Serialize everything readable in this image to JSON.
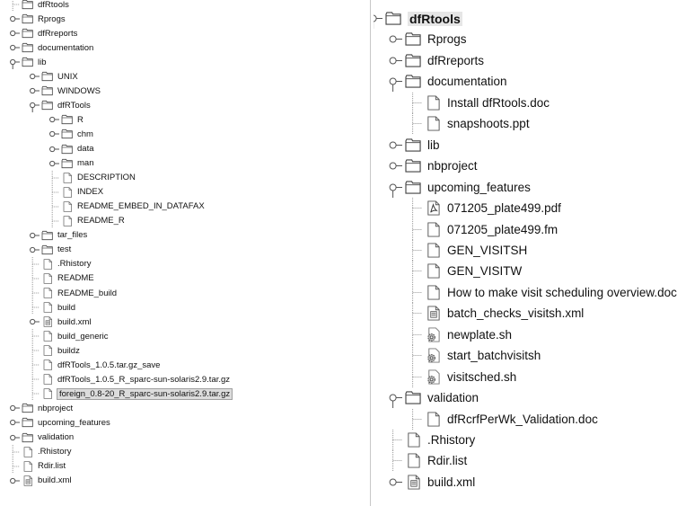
{
  "left_tree": {
    "rows": [
      {
        "label": "dfRtools",
        "depth": 0,
        "icon": "folder-icon",
        "state": "cut"
      },
      {
        "label": "Rprogs",
        "depth": 0,
        "icon": "folder-icon",
        "state": "collapsed"
      },
      {
        "label": "dfRreports",
        "depth": 0,
        "icon": "folder-icon",
        "state": "collapsed"
      },
      {
        "label": "documentation",
        "depth": 0,
        "icon": "folder-icon",
        "state": "collapsed"
      },
      {
        "label": "lib",
        "depth": 0,
        "icon": "folder-icon",
        "state": "expanded"
      },
      {
        "label": "UNIX",
        "depth": 1,
        "icon": "folder-icon",
        "state": "collapsed"
      },
      {
        "label": "WINDOWS",
        "depth": 1,
        "icon": "folder-icon",
        "state": "collapsed"
      },
      {
        "label": "dfRTools",
        "depth": 1,
        "icon": "folder-icon",
        "state": "expanded"
      },
      {
        "label": "R",
        "depth": 2,
        "icon": "folder-icon",
        "state": "collapsed"
      },
      {
        "label": "chm",
        "depth": 2,
        "icon": "folder-icon",
        "state": "collapsed"
      },
      {
        "label": "data",
        "depth": 2,
        "icon": "folder-icon",
        "state": "collapsed"
      },
      {
        "label": "man",
        "depth": 2,
        "icon": "folder-icon",
        "state": "collapsed"
      },
      {
        "label": "DESCRIPTION",
        "depth": 2,
        "icon": "file-icon",
        "state": "leaf"
      },
      {
        "label": "INDEX",
        "depth": 2,
        "icon": "file-icon",
        "state": "leaf"
      },
      {
        "label": "README_EMBED_IN_DATAFAX",
        "depth": 2,
        "icon": "file-icon",
        "state": "leaf"
      },
      {
        "label": "README_R",
        "depth": 2,
        "icon": "file-icon",
        "state": "leaf"
      },
      {
        "label": "tar_files",
        "depth": 1,
        "icon": "folder-icon",
        "state": "collapsed"
      },
      {
        "label": "test",
        "depth": 1,
        "icon": "folder-icon",
        "state": "collapsed"
      },
      {
        "label": ".Rhistory",
        "depth": 1,
        "icon": "file-icon",
        "state": "leaf"
      },
      {
        "label": "README",
        "depth": 1,
        "icon": "file-icon",
        "state": "leaf"
      },
      {
        "label": "README_build",
        "depth": 1,
        "icon": "file-icon",
        "state": "leaf"
      },
      {
        "label": "build",
        "depth": 1,
        "icon": "file-icon",
        "state": "leaf"
      },
      {
        "label": "build.xml",
        "depth": 1,
        "icon": "xml-file-icon",
        "state": "collapsed"
      },
      {
        "label": "build_generic",
        "depth": 1,
        "icon": "file-icon",
        "state": "leaf"
      },
      {
        "label": "buildz",
        "depth": 1,
        "icon": "file-icon",
        "state": "leaf"
      },
      {
        "label": "dfRTools_1.0.5.tar.gz_save",
        "depth": 1,
        "icon": "file-icon",
        "state": "leaf"
      },
      {
        "label": "dfRTools_1.0.5_R_sparc-sun-solaris2.9.tar.gz",
        "depth": 1,
        "icon": "file-icon",
        "state": "leaf"
      },
      {
        "label": "foreign_0.8-20_R_sparc-sun-solaris2.9.tar.gz",
        "depth": 1,
        "icon": "file-icon",
        "state": "leaf",
        "selected": true
      },
      {
        "label": "nbproject",
        "depth": 0,
        "icon": "folder-icon",
        "state": "collapsed"
      },
      {
        "label": "upcoming_features",
        "depth": 0,
        "icon": "folder-icon",
        "state": "collapsed"
      },
      {
        "label": "validation",
        "depth": 0,
        "icon": "folder-icon",
        "state": "collapsed"
      },
      {
        "label": ".Rhistory",
        "depth": 0,
        "icon": "file-icon",
        "state": "leaf"
      },
      {
        "label": "Rdir.list",
        "depth": 0,
        "icon": "file-icon",
        "state": "leaf"
      },
      {
        "label": "build.xml",
        "depth": 0,
        "icon": "xml-file-icon",
        "state": "collapsed"
      }
    ]
  },
  "right_tree": {
    "rows": [
      {
        "label": "dfRtools",
        "depth": 0,
        "icon": "folder-icon",
        "state": "root"
      },
      {
        "label": "Rprogs",
        "depth": 1,
        "icon": "folder-icon",
        "state": "collapsed"
      },
      {
        "label": "dfRreports",
        "depth": 1,
        "icon": "folder-icon",
        "state": "collapsed"
      },
      {
        "label": "documentation",
        "depth": 1,
        "icon": "folder-icon",
        "state": "expanded"
      },
      {
        "label": "Install dfRtools.doc",
        "depth": 2,
        "icon": "file-icon",
        "state": "leaf"
      },
      {
        "label": "snapshoots.ppt",
        "depth": 2,
        "icon": "file-icon",
        "state": "leaf"
      },
      {
        "label": "lib",
        "depth": 1,
        "icon": "folder-icon",
        "state": "collapsed"
      },
      {
        "label": "nbproject",
        "depth": 1,
        "icon": "folder-icon",
        "state": "collapsed"
      },
      {
        "label": "upcoming_features",
        "depth": 1,
        "icon": "folder-icon",
        "state": "expanded"
      },
      {
        "label": "071205_plate499.pdf",
        "depth": 2,
        "icon": "pdf-file-icon",
        "state": "leaf"
      },
      {
        "label": "071205_plate499.fm",
        "depth": 2,
        "icon": "file-icon",
        "state": "leaf"
      },
      {
        "label": "GEN_VISITSH",
        "depth": 2,
        "icon": "file-icon",
        "state": "leaf"
      },
      {
        "label": "GEN_VISITW",
        "depth": 2,
        "icon": "file-icon",
        "state": "leaf"
      },
      {
        "label": "How to make visit scheduling overview.doc",
        "depth": 2,
        "icon": "file-icon",
        "state": "leaf"
      },
      {
        "label": "batch_checks_visitsh.xml",
        "depth": 2,
        "icon": "xml-file-icon",
        "state": "leaf"
      },
      {
        "label": "newplate.sh",
        "depth": 2,
        "icon": "gear-file-icon",
        "state": "leaf"
      },
      {
        "label": "start_batchvisitsh",
        "depth": 2,
        "icon": "gear-file-icon",
        "state": "leaf"
      },
      {
        "label": "visitsched.sh",
        "depth": 2,
        "icon": "gear-file-icon",
        "state": "leaf"
      },
      {
        "label": "validation",
        "depth": 1,
        "icon": "folder-icon",
        "state": "expanded"
      },
      {
        "label": "dfRcrfPerWk_Validation.doc",
        "depth": 2,
        "icon": "file-icon",
        "state": "leaf"
      },
      {
        "label": ".Rhistory",
        "depth": 1,
        "icon": "file-icon",
        "state": "leaf"
      },
      {
        "label": "Rdir.list",
        "depth": 1,
        "icon": "file-icon",
        "state": "leaf"
      },
      {
        "label": "build.xml",
        "depth": 1,
        "icon": "xml-file-icon",
        "state": "collapsed"
      }
    ]
  }
}
